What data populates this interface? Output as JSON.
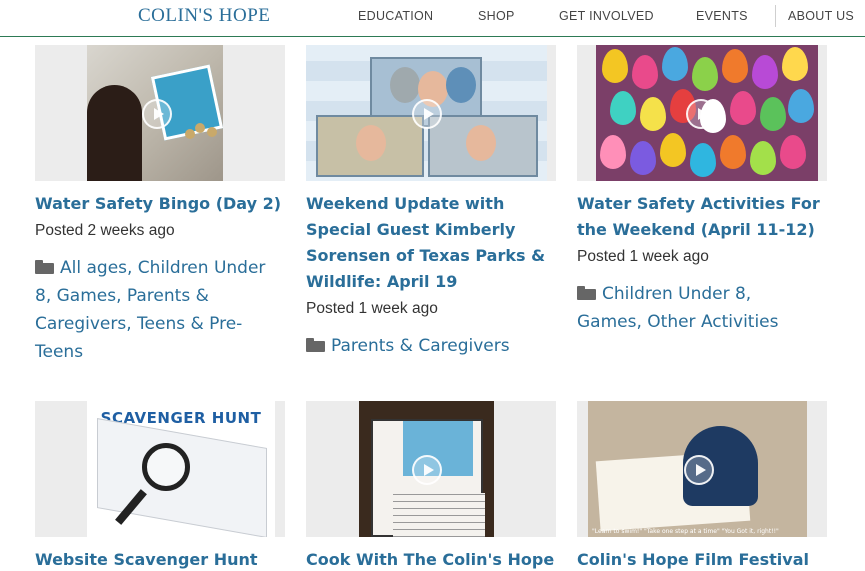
{
  "header": {
    "logo": "COLIN'S HOPE",
    "nav": [
      "EDUCATION",
      "SHOP",
      "GET INVOLVED",
      "EVENTS",
      "ABOUT US"
    ]
  },
  "cards": [
    {
      "title_lines": [
        "Water Safety Bingo (Day 2)"
      ],
      "posted": "Posted 2 weeks ago",
      "category_lines": [
        "All ages, Children Under",
        "8, Games, Parents &",
        "Caregivers, Teens & Pre-",
        "Teens"
      ]
    },
    {
      "title_lines": [
        "Weekend Update with",
        "Special Guest Kimberly",
        "Sorensen of Texas Parks &",
        "Wildlife: April 19"
      ],
      "posted": "Posted 1 week ago",
      "category_lines": [
        "Parents & Caregivers"
      ]
    },
    {
      "title_lines": [
        "Water Safety Activities For",
        "the Weekend (April 11-12)"
      ],
      "posted": "Posted 1 week ago",
      "category_lines": [
        "Children Under 8,",
        "Games, Other Activities"
      ]
    },
    {
      "title_lines": [
        "Website Scavenger Hunt on"
      ],
      "thumb_text": "SCAVENGER HUNT"
    },
    {
      "title_lines": [
        "Cook With The Colin's Hope"
      ]
    },
    {
      "title_lines": [
        "Colin's Hope Film Festival —"
      ],
      "thumb_caption": "\"Learn to swim!\" \"Take one step at a time\" \"You Got it, right!!\""
    }
  ]
}
